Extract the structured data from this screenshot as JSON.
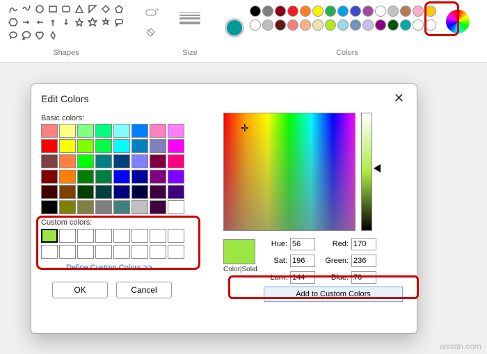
{
  "ribbon": {
    "shapes_label": "Shapes",
    "size_label": "Size",
    "colors_label": "Colors",
    "current_color": "#009999",
    "palette_row1": [
      "#000000",
      "#7f7f7f",
      "#880015",
      "#ed1c24",
      "#ff7f27",
      "#fff200",
      "#22b14c",
      "#00a2e8",
      "#3f48cc",
      "#a349a4",
      "#ffffff",
      "#c3c3c3",
      "#b97a57",
      "#ffaec9",
      "#ffc90e"
    ],
    "palette_row2": [
      "#ffffff",
      "#c0c0c0",
      "#651818",
      "#f28080",
      "#ffb27f",
      "#efe4b0",
      "#b5e61d",
      "#99d9ea",
      "#7092be",
      "#c8bfe7",
      "#880088",
      "#005500",
      "#00AAAA",
      "#ffffff",
      "#ffffff"
    ]
  },
  "dialog": {
    "title": "Edit Colors",
    "close": "✕",
    "basic_label": "Basic colors:",
    "custom_label": "Custom colors:",
    "define": "Define Custom Colors >>",
    "ok": "OK",
    "cancel": "Cancel",
    "preview_label": "Color|Solid",
    "preview_color": "#9be644",
    "hue_lbl": "Hue:",
    "hue": "56",
    "sat_lbl": "Sat:",
    "sat": "196",
    "lum_lbl": "Lum:",
    "lum": "144",
    "red_lbl": "Red:",
    "red": "170",
    "green_lbl": "Green:",
    "green": "236",
    "blue_lbl": "Blue:",
    "blue": "70",
    "add": "Add to Custom Colors",
    "basic_colors": [
      "#ff8080",
      "#ffff80",
      "#80ff80",
      "#00ff80",
      "#80ffff",
      "#0080ff",
      "#ff80c0",
      "#ff80ff",
      "#ff0000",
      "#ffff00",
      "#80ff00",
      "#00ff40",
      "#00ffff",
      "#0080c0",
      "#8080c0",
      "#ff00ff",
      "#804040",
      "#ff8040",
      "#00ff00",
      "#008080",
      "#004080",
      "#8080ff",
      "#800040",
      "#ff0080",
      "#800000",
      "#ff8000",
      "#008000",
      "#008040",
      "#0000ff",
      "#0000a0",
      "#800080",
      "#8000ff",
      "#400000",
      "#804000",
      "#004000",
      "#004040",
      "#000080",
      "#000040",
      "#400040",
      "#400080",
      "#000000",
      "#808000",
      "#808040",
      "#808080",
      "#408080",
      "#c0c0c0",
      "#400040",
      "#ffffff"
    ],
    "custom_first": "#9be644"
  },
  "watermark": "wsxdn.com"
}
